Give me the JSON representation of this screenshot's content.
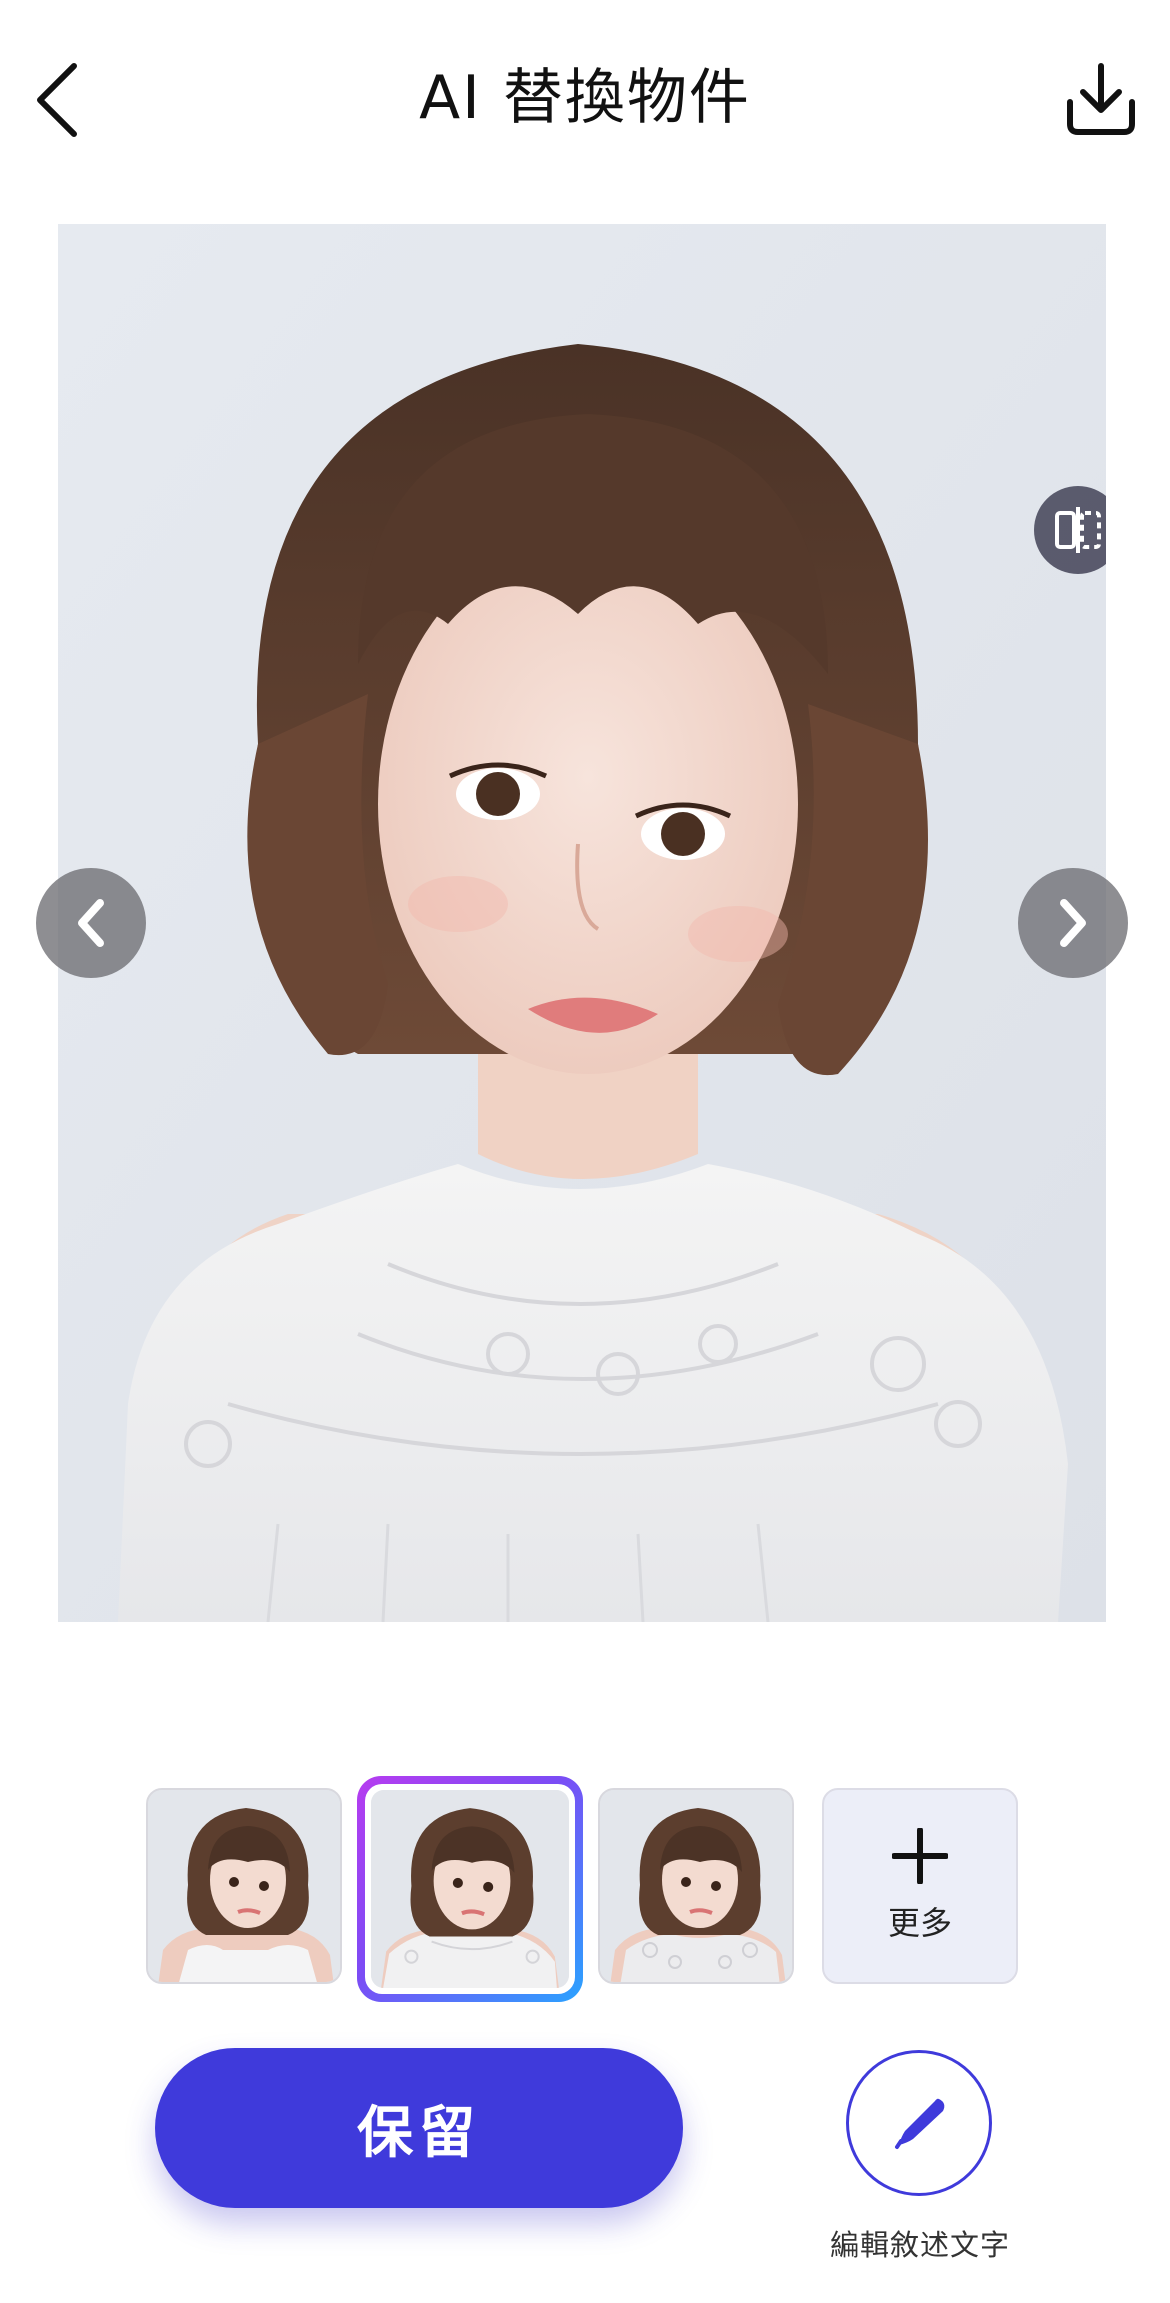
{
  "header": {
    "title": "AI 替換物件",
    "back_icon": "chevron-left-icon",
    "download_icon": "download-icon"
  },
  "preview": {
    "compare_icon": "compare-split-icon",
    "prev_icon": "chevron-left-icon",
    "next_icon": "chevron-right-icon"
  },
  "variations": {
    "items": [
      {
        "name": "variation-1",
        "top_style": "sheer-white-blouse",
        "selected": false
      },
      {
        "name": "variation-2",
        "top_style": "white-lace-blouse",
        "selected": true
      },
      {
        "name": "variation-3",
        "top_style": "lace-cap-sleeve-top",
        "selected": false
      }
    ],
    "more_label": "更多",
    "selected_border_colors": [
      "#b73cf0",
      "#2aa3ff"
    ]
  },
  "actions": {
    "keep_label": "保留",
    "edit_label": "編輯敘述文字",
    "edit_icon": "pen-icon"
  },
  "colors": {
    "accent": "#3f3adb",
    "title_text": "#111111",
    "background": "#ffffff"
  }
}
